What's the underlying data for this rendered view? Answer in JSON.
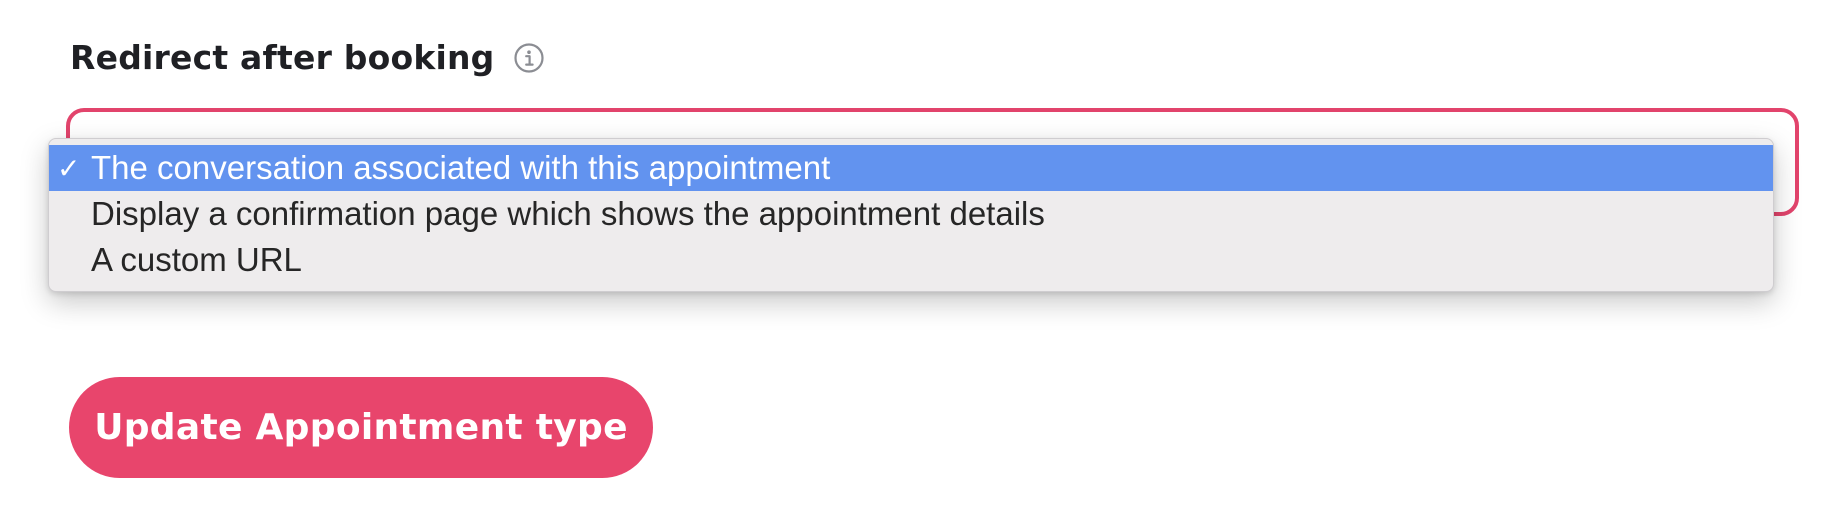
{
  "field": {
    "label": "Redirect after booking",
    "info_icon": "info-circle-icon"
  },
  "dropdown": {
    "selected_index": 0,
    "checkmark": "✓",
    "options": [
      {
        "label": "The conversation associated with this appointment"
      },
      {
        "label": "Display a confirmation page which shows the appointment details"
      },
      {
        "label": "A custom URL"
      }
    ]
  },
  "actions": {
    "update_label": "Update Appointment type"
  },
  "colors": {
    "accent": "#e8456c",
    "select_border": "#e2446c",
    "highlight": "#6293ef",
    "menu_background": "#eeeced"
  }
}
